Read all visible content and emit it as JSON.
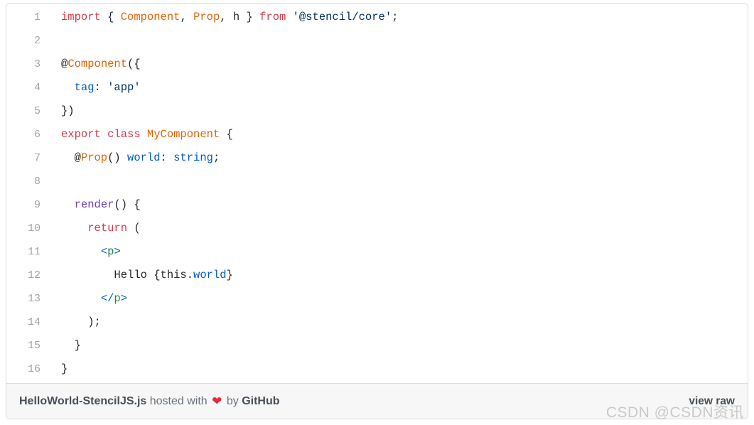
{
  "gist": {
    "language": "typescript",
    "code_lines": [
      {
        "number": "1",
        "tokens": [
          {
            "text": "import ",
            "style": "k"
          },
          {
            "text": "{ ",
            "style": "p"
          },
          {
            "text": "Component",
            "style": "e"
          },
          {
            "text": ", ",
            "style": "p"
          },
          {
            "text": "Prop",
            "style": "e"
          },
          {
            "text": ", h } ",
            "style": "p"
          },
          {
            "text": "from ",
            "style": "k"
          },
          {
            "text": "'@stencil/core'",
            "style": "s"
          },
          {
            "text": ";",
            "style": "p"
          }
        ]
      },
      {
        "number": "2",
        "tokens": []
      },
      {
        "number": "3",
        "tokens": [
          {
            "text": "@",
            "style": "p"
          },
          {
            "text": "Component",
            "style": "e"
          },
          {
            "text": "({",
            "style": "p"
          }
        ]
      },
      {
        "number": "4",
        "tokens": [
          {
            "text": "  ",
            "style": "p"
          },
          {
            "text": "tag",
            "style": "v"
          },
          {
            "text": ": ",
            "style": "p"
          },
          {
            "text": "'app'",
            "style": "s"
          }
        ]
      },
      {
        "number": "5",
        "tokens": [
          {
            "text": "})",
            "style": "p"
          }
        ]
      },
      {
        "number": "6",
        "tokens": [
          {
            "text": "export class ",
            "style": "k"
          },
          {
            "text": "MyComponent",
            "style": "e"
          },
          {
            "text": " {",
            "style": "p"
          }
        ]
      },
      {
        "number": "7",
        "tokens": [
          {
            "text": "  @",
            "style": "p"
          },
          {
            "text": "Prop",
            "style": "e"
          },
          {
            "text": "() ",
            "style": "p"
          },
          {
            "text": "world",
            "style": "v"
          },
          {
            "text": ": ",
            "style": "p"
          },
          {
            "text": "string",
            "style": "v"
          },
          {
            "text": ";",
            "style": "p"
          }
        ]
      },
      {
        "number": "8",
        "tokens": []
      },
      {
        "number": "9",
        "tokens": [
          {
            "text": "  ",
            "style": "p"
          },
          {
            "text": "render",
            "style": "f"
          },
          {
            "text": "() {",
            "style": "p"
          }
        ]
      },
      {
        "number": "10",
        "tokens": [
          {
            "text": "    ",
            "style": "p"
          },
          {
            "text": "return",
            "style": "k"
          },
          {
            "text": " (",
            "style": "p"
          }
        ]
      },
      {
        "number": "11",
        "tokens": [
          {
            "text": "      ",
            "style": "p"
          },
          {
            "text": "<",
            "style": "v"
          },
          {
            "text": "p",
            "style": "t"
          },
          {
            "text": ">",
            "style": "v"
          }
        ]
      },
      {
        "number": "12",
        "tokens": [
          {
            "text": "        Hello {this.",
            "style": "p"
          },
          {
            "text": "world",
            "style": "v"
          },
          {
            "text": "}",
            "style": "p"
          }
        ]
      },
      {
        "number": "13",
        "tokens": [
          {
            "text": "      ",
            "style": "p"
          },
          {
            "text": "</",
            "style": "v"
          },
          {
            "text": "p",
            "style": "t"
          },
          {
            "text": ">",
            "style": "v"
          }
        ]
      },
      {
        "number": "14",
        "tokens": [
          {
            "text": "    );",
            "style": "p"
          }
        ]
      },
      {
        "number": "15",
        "tokens": [
          {
            "text": "  }",
            "style": "p"
          }
        ]
      },
      {
        "number": "16",
        "tokens": [
          {
            "text": "}",
            "style": "p"
          }
        ]
      }
    ],
    "footer": {
      "filename": "HelloWorld-StencilJS.js",
      "hosted_with": "hosted with",
      "heart_icon": "heart-icon",
      "heart_glyph": "❤",
      "by": "by",
      "host": "GitHub",
      "view_raw_label": "view raw"
    }
  },
  "watermark": {
    "text": "CSDN @CSDN资讯"
  },
  "colors": {
    "keyword": "#d73a49",
    "entity": "#e36209",
    "variable": "#005cc5",
    "string": "#032f62",
    "function": "#6f42c1",
    "tag": "#22863a",
    "plain": "#24292e",
    "line_number": "#a3a3a3",
    "border": "#dddddd",
    "footer_bg": "#f7f7f7",
    "heart": "#e8273c",
    "watermark": "#c9c9c9"
  }
}
